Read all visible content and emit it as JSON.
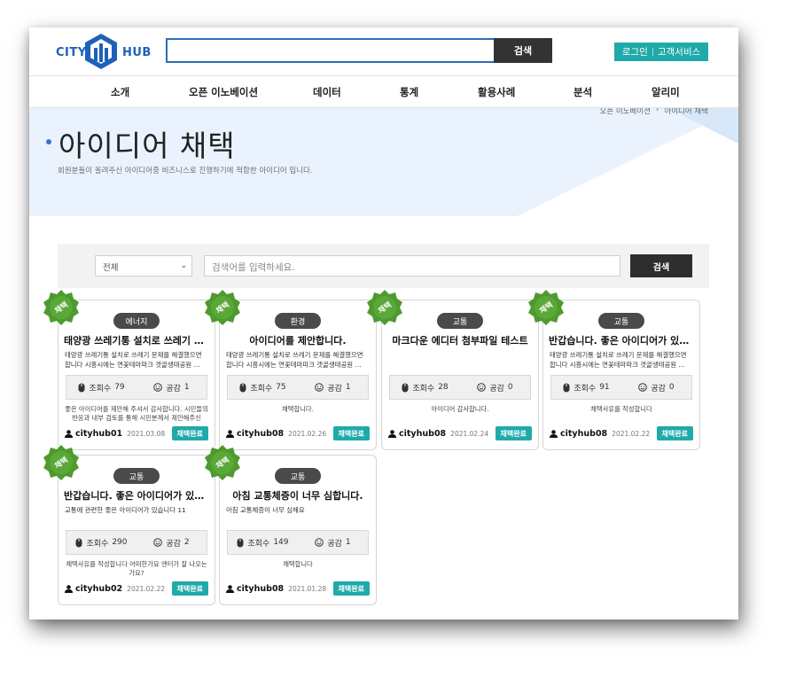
{
  "header": {
    "logo_left": "CITY",
    "logo_right": "HUB",
    "search_button": "검색",
    "login": "로그인",
    "customer_service": "고객서비스"
  },
  "nav": [
    "소개",
    "오픈 이노베이션",
    "데이터",
    "통계",
    "활용사례",
    "분석",
    "알리미"
  ],
  "breadcrumb": {
    "parent": "오픈 이노베이션",
    "current": "아이디어 채택"
  },
  "hero": {
    "title": "아이디어 채택",
    "subtitle": "회원분들이 올려주신 아이디어중 비즈니스로 진행하기에 적합한 아이디어 입니다."
  },
  "filter": {
    "select_value": "전체",
    "search_placeholder": "검색어를 입력하세요.",
    "search_button": "검색"
  },
  "seal_label": "채택",
  "labels": {
    "views": "조회수",
    "likes": "공감"
  },
  "cards": [
    {
      "category": "에너지",
      "title": "태양광 쓰레기통 설치로 쓰레기 문…",
      "desc": "태양광 쓰레기통 설치로 쓰레기 문제를 해결했으면 합니다 시흥시에는 연꽃테마파크 갯골생태공원 …",
      "views": "79",
      "likes": "1",
      "reply": "좋은 아이디어를 제안해 주셔서 감사합니다. 시민들의 반응과 내부 검토를 통해 시민분께서 제안해주신 아…",
      "user": "cityhub01",
      "date": "2021.03.08",
      "status": "채택완료"
    },
    {
      "category": "환경",
      "title": "아이디어를 제안합니다.",
      "desc": "태양광 쓰레기통 설치로 쓰레기 문제를 해결했으면 합니다 시흥시에는 연꽃테마파크 갯골생태공원 …",
      "views": "75",
      "likes": "1",
      "reply": "채택합니다.",
      "user": "cityhub08",
      "date": "2021.02.26",
      "status": "채택완료"
    },
    {
      "category": "교통",
      "title": "마크다운 에디터 첨부파일 테스트",
      "desc": "",
      "views": "28",
      "likes": "0",
      "reply": "아이디어 감사합니다.",
      "user": "cityhub08",
      "date": "2021.02.24",
      "status": "채택완료"
    },
    {
      "category": "교통",
      "title": "반갑습니다. 좋은 아이디어가 있어요",
      "desc": "태양광 쓰레기통 설치로 쓰레기 문제를 해결했으면 합니다 시흥시에는 연꽃테마파크 갯골생태공원 …",
      "views": "91",
      "likes": "0",
      "reply": "채택사유를 작성합니다",
      "user": "cityhub08",
      "date": "2021.02.22",
      "status": "채택완료"
    },
    {
      "category": "교통",
      "title": "반갑습니다. 좋은 아이디어가 있어요",
      "desc": "교통에 관련한 좋은 아이디어가 있습니다 11",
      "views": "290",
      "likes": "2",
      "reply": "채택사유를 작성합니다 어떠한가요 엔터가 잘 나오는가요?",
      "user": "cityhub02",
      "date": "2021.02.22",
      "status": "채택완료"
    },
    {
      "category": "교통",
      "title": "아침 교통체증이 너무 심합니다.",
      "desc": "아침 교통체증이 너무 심해요",
      "views": "149",
      "likes": "1",
      "reply": "채택합니다",
      "user": "cityhub08",
      "date": "2021.01.28",
      "status": "채택완료"
    }
  ],
  "colors": {
    "accent": "#1faaa9",
    "brand": "#1e62b8",
    "seal": "#4e9a2e",
    "hero_bg": "#eaf3fd"
  }
}
